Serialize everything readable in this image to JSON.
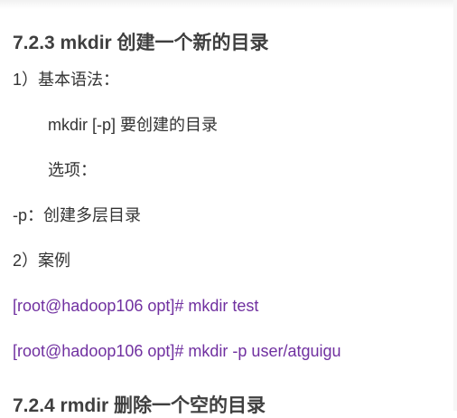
{
  "section1": {
    "title": "7.2.3 mkdir 创建一个新的目录",
    "basic_syntax_label": "1）基本语法：",
    "syntax": "mkdir [-p] 要创建的目录",
    "options_label": "选项：",
    "option_p": "-p：创建多层目录",
    "example_label": "2）案例",
    "commands": [
      "[root@hadoop106 opt]# mkdir test",
      "[root@hadoop106 opt]# mkdir -p user/atguigu"
    ]
  },
  "section2": {
    "title": "7.2.4 rmdir 删除一个空的目录"
  },
  "colors": {
    "command_text": "#7030a0",
    "body_text": "#333333"
  }
}
